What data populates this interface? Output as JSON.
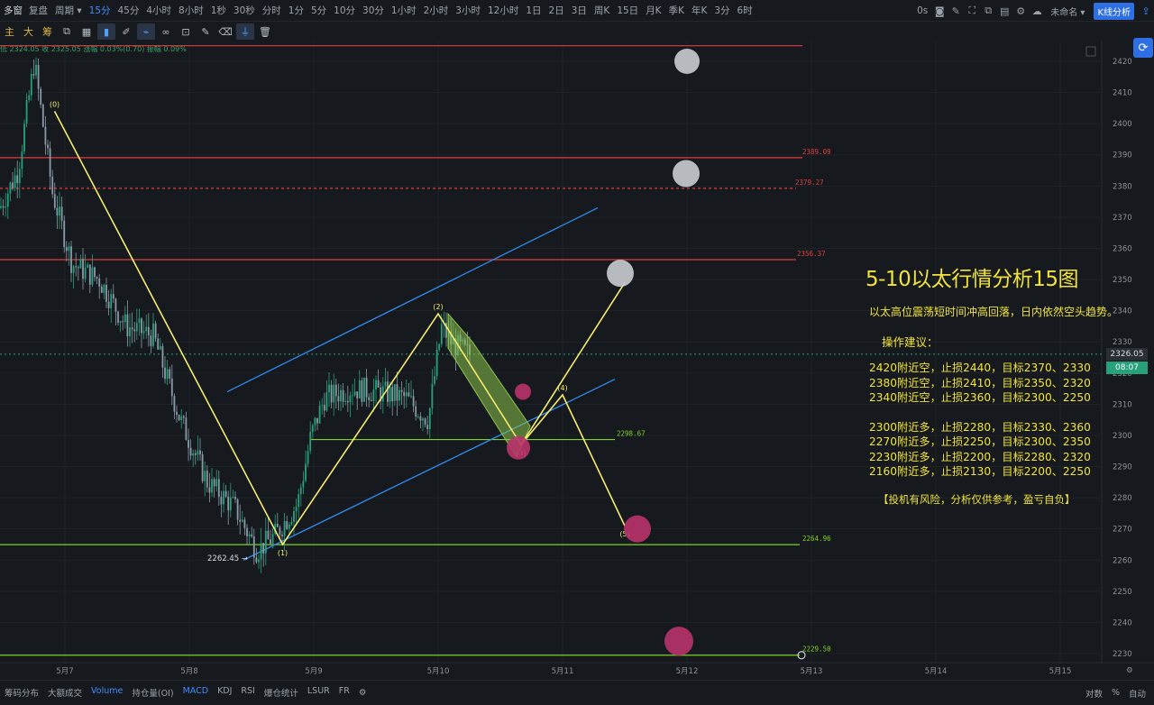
{
  "topbar": {
    "logo": "多窗",
    "replay": "复盘",
    "period_label": "周期",
    "intervals": [
      "15分",
      "45分",
      "4小时",
      "8小时",
      "1秒",
      "30秒",
      "分时",
      "1分",
      "5分",
      "10分",
      "30分",
      "1小时",
      "2小时",
      "3小时",
      "12小时",
      "1日",
      "2日",
      "3日",
      "周K",
      "15日",
      "月K",
      "季K",
      "年K",
      "3分",
      "6时"
    ],
    "active_interval": "15分",
    "countdown_label": "0s",
    "account": "未命名",
    "kline_button": "K线分析"
  },
  "toolbar": {
    "main_label": "主",
    "big_label": "大",
    "chip_label": "筹"
  },
  "ohlc_readout": "低 2324.05  收 2325.05  涨幅 0.03%(0.70)  振幅 0.09%",
  "chart_data": {
    "type": "candlestick",
    "symbol": "以太",
    "x_ticks": [
      "5月7",
      "5月8",
      "5月9",
      "5月10",
      "5月11",
      "5月12",
      "5月13",
      "5月14",
      "5月15"
    ],
    "y_ticks": [
      2230,
      2240,
      2250,
      2260,
      2270,
      2280,
      2290,
      2300,
      2310,
      2320,
      2330,
      2340,
      2350,
      2360,
      2370,
      2380,
      2390,
      2400,
      2410,
      2420
    ],
    "ylim": [
      2225,
      2425
    ],
    "last_price": "2326.05",
    "countdown": "08:07",
    "low_marker": "2262.45",
    "horizontal_levels": [
      {
        "label": "",
        "value": 2425,
        "style": "solid",
        "color": "#e03c3c"
      },
      {
        "label": "2389.09",
        "value": 2389.09,
        "style": "solid",
        "color": "#e03c3c"
      },
      {
        "label": "2379.27",
        "value": 2379.27,
        "style": "dashed",
        "color": "#e03c3c"
      },
      {
        "label": "2356.37",
        "value": 2356.37,
        "style": "solid",
        "color": "#e03c3c"
      },
      {
        "label": "2298.67",
        "value": 2298.67,
        "style": "solid",
        "color": "#7ed321"
      },
      {
        "label": "2264.96",
        "value": 2264.96,
        "style": "solid",
        "color": "#7ed321"
      },
      {
        "label": "2229.50",
        "value": 2229.5,
        "style": "solid",
        "color": "#7ed321"
      }
    ],
    "wave_points": [
      {
        "label": "(0)",
        "x": "5月6 22:00",
        "y": 2404
      },
      {
        "label": "(1)",
        "x": "5月8 18:00",
        "y": 2265
      },
      {
        "label": "(2)",
        "x": "5月10 00:00",
        "y": 2339
      },
      {
        "label": "(3)",
        "x": "5月10 16:00",
        "y": 2297
      },
      {
        "label": "(4)",
        "x": "5月11 00:00",
        "y": 2313
      },
      {
        "label": "(5)",
        "x": "5月11 12:00",
        "y": 2271
      }
    ],
    "alt_wave": [
      {
        "x": "5月10 16:00",
        "y": 2297
      },
      {
        "x": "5月11 12:00",
        "y": 2349
      }
    ],
    "colors": {
      "up": "#26a17b",
      "down": "#8a9aa8",
      "wave": "#f5ec6e",
      "channel": "#2f8cf0",
      "flag": "#8bc34a"
    }
  },
  "analysis": {
    "title": "5-10以太行情分析15图",
    "intro": "以太高位震荡短时间冲高回落，日内依然空头趋势。",
    "ops_title": "操作建议：",
    "short_lines": [
      "2420附近空，止损2440，目标2370、2330",
      "2380附近空，止损2410，目标2350、2320",
      "2340附近空，止损2360，目标2300、2250"
    ],
    "long_lines": [
      "2300附近多，止损2280，目标2330、2360",
      "2270附近多，止损2250，目标2300、2350",
      "2230附近多，止损2200，目标2280、2320",
      "2160附近多，止损2130，目标2200、2250"
    ],
    "disclaimer": "【投机有风险，分析仅供参考，盈亏自负】"
  },
  "bottombar": {
    "items": [
      "筹码分布",
      "大额成交",
      "Volume",
      "持仓量(OI)",
      "MACD",
      "KDJ",
      "RSI",
      "爆仓统计",
      "LSUR",
      "FR"
    ],
    "active": [
      "Volume",
      "MACD"
    ],
    "right": [
      "对数",
      "%",
      "自动"
    ]
  }
}
